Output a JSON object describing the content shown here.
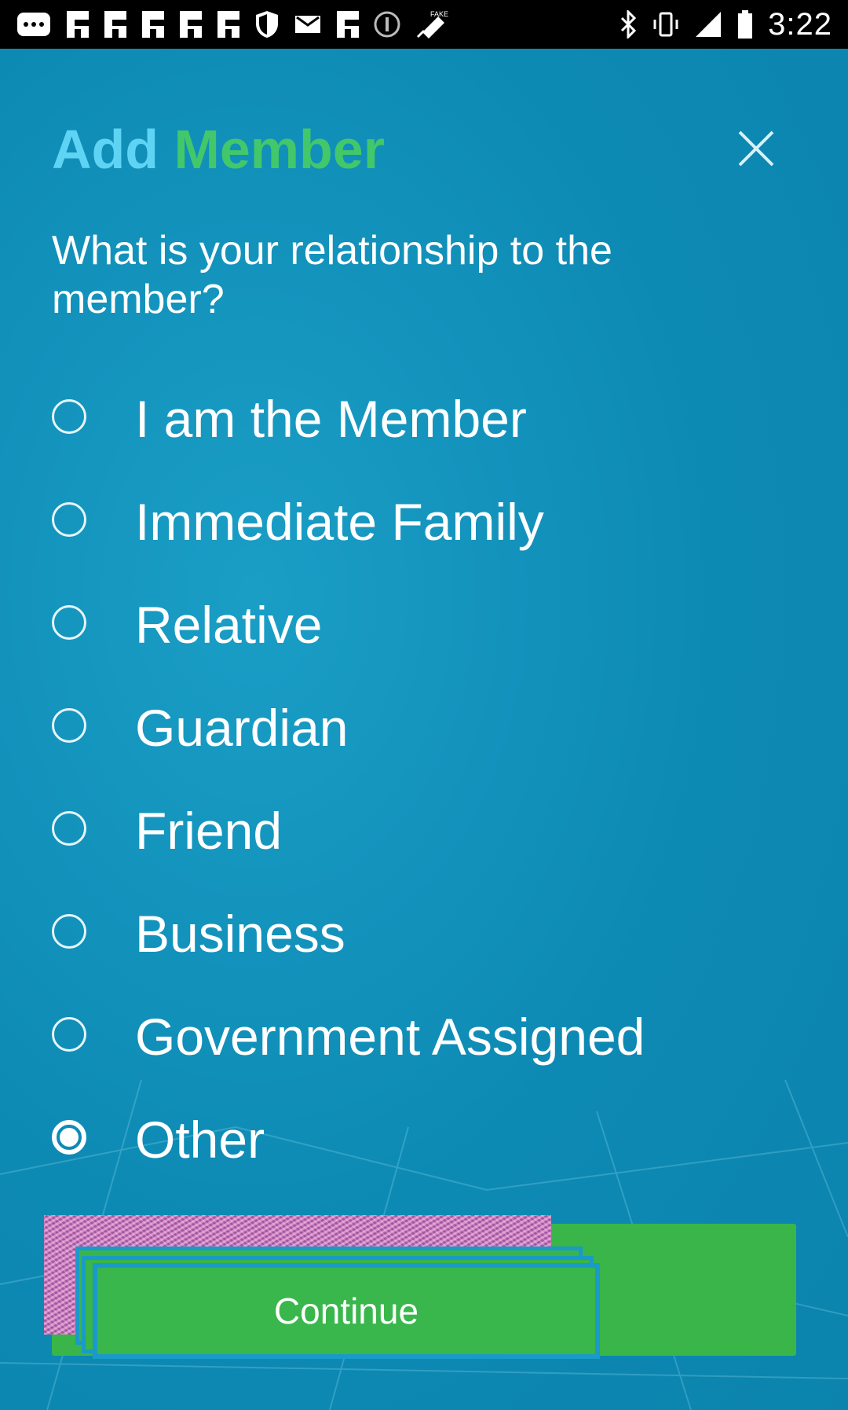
{
  "status_bar": {
    "time": "3:22",
    "icons_left": [
      "message-icon",
      "flipboard-icon",
      "flipboard-icon",
      "flipboard-icon",
      "flipboard-icon",
      "flipboard-icon",
      "shield-icon",
      "email-icon",
      "flipboard-icon",
      "info-icon",
      "fake-gps-icon"
    ],
    "icons_right": [
      "bluetooth-icon",
      "vibrate-icon",
      "signal-icon",
      "battery-icon"
    ]
  },
  "header": {
    "title_part1": "Add",
    "title_part2": "Member",
    "close_icon": "close-icon",
    "title_colors": {
      "add": "#5fd3f3",
      "member": "#42c76a"
    }
  },
  "question": "What is your relationship to the member?",
  "options": [
    {
      "label": "I am the Member",
      "checked": false
    },
    {
      "label": "Immediate Family",
      "checked": false
    },
    {
      "label": "Relative",
      "checked": false
    },
    {
      "label": "Guardian",
      "checked": false
    },
    {
      "label": "Friend",
      "checked": false
    },
    {
      "label": "Business",
      "checked": false
    },
    {
      "label": "Government Assigned",
      "checked": false
    },
    {
      "label": "Other",
      "checked": true
    }
  ],
  "continue_label": "Continue",
  "colors": {
    "background": "#0f8fb7",
    "button_green": "#39b54a",
    "frame_blue": "#1a9ac8"
  }
}
